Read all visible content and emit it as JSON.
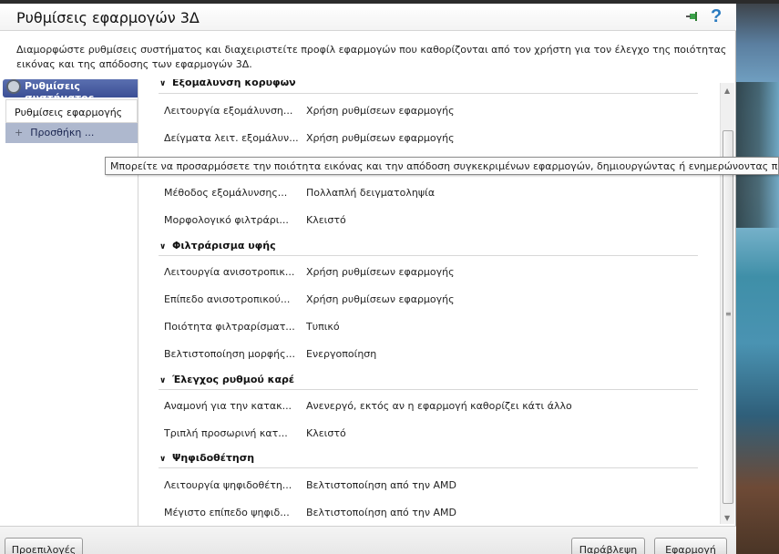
{
  "window": {
    "title": "Ρυθμίσεις εφαρμογών 3Δ",
    "description": "Διαμορφώστε ρυθμίσεις συστήματος και διαχειριστείτε προφίλ εφαρμογών που καθορίζονται από τον χρήστη για τον έλεγχο της ποιότητας εικόνας και της απόδοσης των εφαρμογών 3Δ."
  },
  "sidebar": {
    "header": "Ρυθμίσεις συστήματος",
    "items": [
      {
        "label": "Ρυθμίσεις εφαρμογής"
      },
      {
        "label": "Προσθήκη ..."
      }
    ]
  },
  "tooltip": "Μπορείτε να προσαρμόσετε την ποιότητα εικόνας και την απόδοση συγκεκριμένων εφαρμογών, δημιουργώντας ή ενημερώνοντας προ",
  "sections": [
    {
      "title": "Εξομάλυνση κορυφών",
      "rows": [
        {
          "label": "Λειτουργία εξομάλυνση...",
          "value": "Χρήση ρυθμίσεων εφαρμογής"
        },
        {
          "label": "Δείγματα λειτ. εξομάλυν...",
          "value": "Χρήση ρυθμίσεων εφαρμογής"
        },
        {
          "label": "Μέθοδος εξομάλυνσης...",
          "value": "Πολλαπλή δειγματοληψία"
        },
        {
          "label": "Μορφολογικό φιλτράρι...",
          "value": "Κλειστό"
        }
      ]
    },
    {
      "title": "Φιλτράρισμα υφής",
      "rows": [
        {
          "label": "Λειτουργία ανισοτροπικ...",
          "value": "Χρήση ρυθμίσεων εφαρμογής"
        },
        {
          "label": "Επίπεδο ανισοτροπικού...",
          "value": "Χρήση ρυθμίσεων εφαρμογής"
        },
        {
          "label": "Ποιότητα φιλτραρίσματ...",
          "value": "Τυπικό"
        },
        {
          "label": "Βελτιστοποίηση μορφής...",
          "value": "Ενεργοποίηση"
        }
      ]
    },
    {
      "title": "Έλεγχος ρυθμού καρέ",
      "rows": [
        {
          "label": "Αναμονή για την κατακ...",
          "value": "Ανενεργό, εκτός αν η εφαρμογή καθορίζει κάτι άλλο"
        },
        {
          "label": "Τριπλή προσωρινή κατ...",
          "value": "Κλειστό"
        }
      ]
    },
    {
      "title": "Ψηφιδοθέτηση",
      "rows": [
        {
          "label": "Λειτουργία ψηφιδοθέτη...",
          "value": "Βελτιστοποίηση από την AMD"
        },
        {
          "label": "Μέγιστο επίπεδο ψηφιδ...",
          "value": "Βελτιστοποίηση από την AMD"
        }
      ]
    }
  ],
  "buttons": {
    "presets": "Προεπιλογές",
    "discard": "Παράβλεψη",
    "apply": "Εφαρμογή"
  },
  "icons": {
    "pin": "pin-icon",
    "help": "?"
  }
}
